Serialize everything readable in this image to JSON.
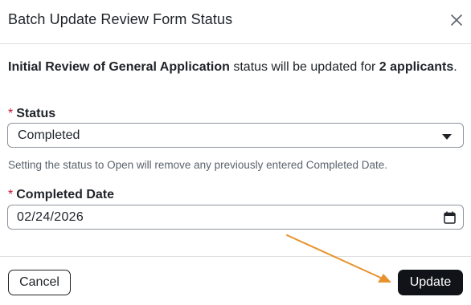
{
  "dialog": {
    "title": "Batch Update Review Form Status",
    "close_icon": "close-icon"
  },
  "intro": {
    "form_name": "Initial Review of General Application",
    "middle_text": " status will be updated for ",
    "count_text": "2 applicants",
    "end_text": "."
  },
  "status_field": {
    "required_marker": "*",
    "label": "Status",
    "value": "Completed",
    "icon": "caret-down-icon",
    "help_text": "Setting the status to Open will remove any previously entered Completed Date."
  },
  "date_field": {
    "required_marker": "*",
    "label": "Completed Date",
    "value": "02/24/2026",
    "icon": "calendar-icon"
  },
  "footer": {
    "cancel_label": "Cancel",
    "update_label": "Update"
  },
  "annotation": {
    "arrow_color": "#e8922e",
    "points_to": "update-button"
  },
  "colors": {
    "primary_button": "#101418",
    "required": "#c8102e",
    "border": "#8d949c"
  }
}
